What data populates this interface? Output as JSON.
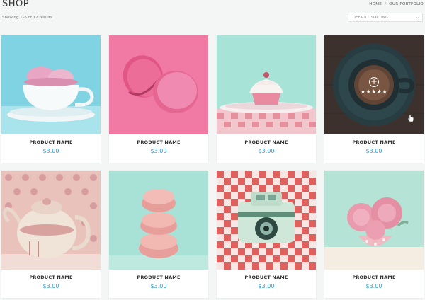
{
  "header": {
    "title": "SHOP",
    "breadcrumb": [
      "HOME",
      "OUR PORTFOLIO"
    ],
    "results": "Showing 1–6 of 17 results",
    "sort_label": "DEFAULT SORTING"
  },
  "products": [
    {
      "name": "PRODUCT NAME",
      "price": "$3.00",
      "icon": "ice-cream-cup-image"
    },
    {
      "name": "PRODUCT NAME",
      "price": "$3.00",
      "icon": "macarons-image"
    },
    {
      "name": "PRODUCT NAME",
      "price": "$3.00",
      "icon": "cupcake-image"
    },
    {
      "name": "PRODUCT NAME",
      "price": "$3.00",
      "icon": "coffee-cup-image",
      "rating": "★★★★★"
    },
    {
      "name": "PRODUCT NAME",
      "price": "$3.00",
      "icon": "teapot-image"
    },
    {
      "name": "PRODUCT NAME",
      "price": "$3.00",
      "icon": "macaron-stack-image"
    },
    {
      "name": "PRODUCT NAME",
      "price": "$3.00",
      "icon": "camera-image"
    },
    {
      "name": "PRODUCT NAME",
      "price": "$3.00",
      "icon": "roses-image"
    }
  ],
  "colors": {
    "price": "#2a9fd6",
    "background": "#f4f5f5"
  }
}
